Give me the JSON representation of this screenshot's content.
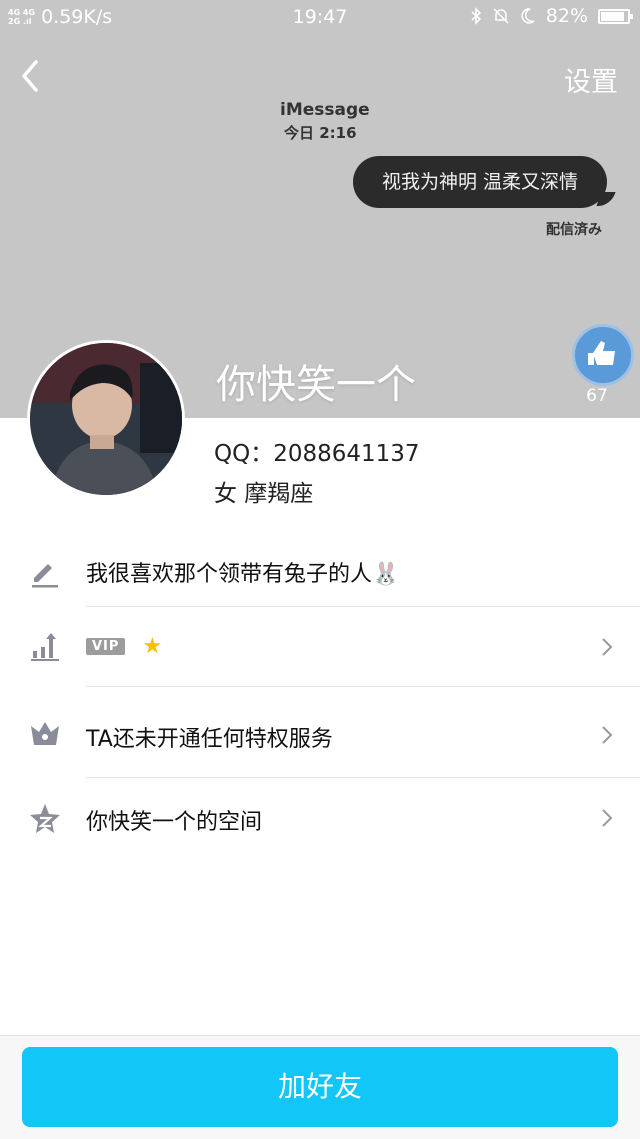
{
  "status": {
    "network": "4G 4G 2G",
    "speed": "0.59K/s",
    "time": "19:47",
    "battery": "82%",
    "battery_level": 0.82
  },
  "header": {
    "settings_label": "设置"
  },
  "cover": {
    "imessage_title": "iMessage",
    "imessage_time": "今日 2:16",
    "bubble_text": "视我为神明 温柔又深情",
    "delivered": "配信済み"
  },
  "profile": {
    "nickname": "你快笑一个",
    "like_count": "67",
    "qq": "QQ：2088641137",
    "gender_zodiac": "女  摩羯座"
  },
  "rows": {
    "signature": "我很喜欢那个领带有兔子的人🐰",
    "vip_badge": "VIP",
    "vip_star": "★",
    "privilege": "TA还未开通任何特权服务",
    "space": "你快笑一个的空间"
  },
  "bottom": {
    "add_friend_label": "加好友"
  },
  "colors": {
    "cover_bg": "#c6c6c6",
    "accent": "#12c7f7",
    "icon_gray": "#8a8d99"
  }
}
